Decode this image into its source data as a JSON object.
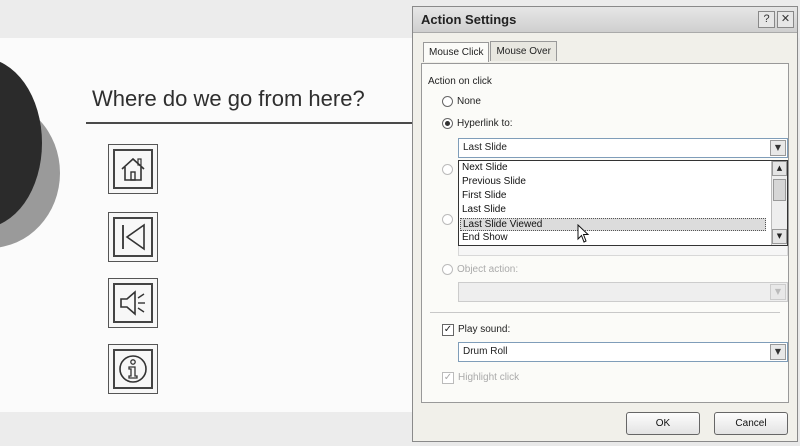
{
  "slide": {
    "title": "Where do we go from here?",
    "action_buttons": [
      "home-icon",
      "back-icon",
      "sound-icon",
      "information-icon"
    ]
  },
  "dialog": {
    "title": "Action Settings",
    "help_glyph": "?",
    "close_glyph": "✕",
    "tabs": [
      "Mouse Click",
      "Mouse Over"
    ],
    "section_label": "Action on click",
    "options": {
      "none": "None",
      "hyperlink": "Hyperlink to:",
      "object_action": "Object action:",
      "play_sound": "Play sound:",
      "highlight_click": "Highlight click"
    },
    "hyperlink_value": "Last Slide",
    "hyperlink_list": [
      "Next Slide",
      "Previous Slide",
      "First Slide",
      "Last Slide",
      "Last Slide Viewed",
      "End Show"
    ],
    "hyperlink_selected": "Last Slide Viewed",
    "sound_value": "Drum Roll",
    "ok_label": "OK",
    "cancel_label": "Cancel"
  }
}
